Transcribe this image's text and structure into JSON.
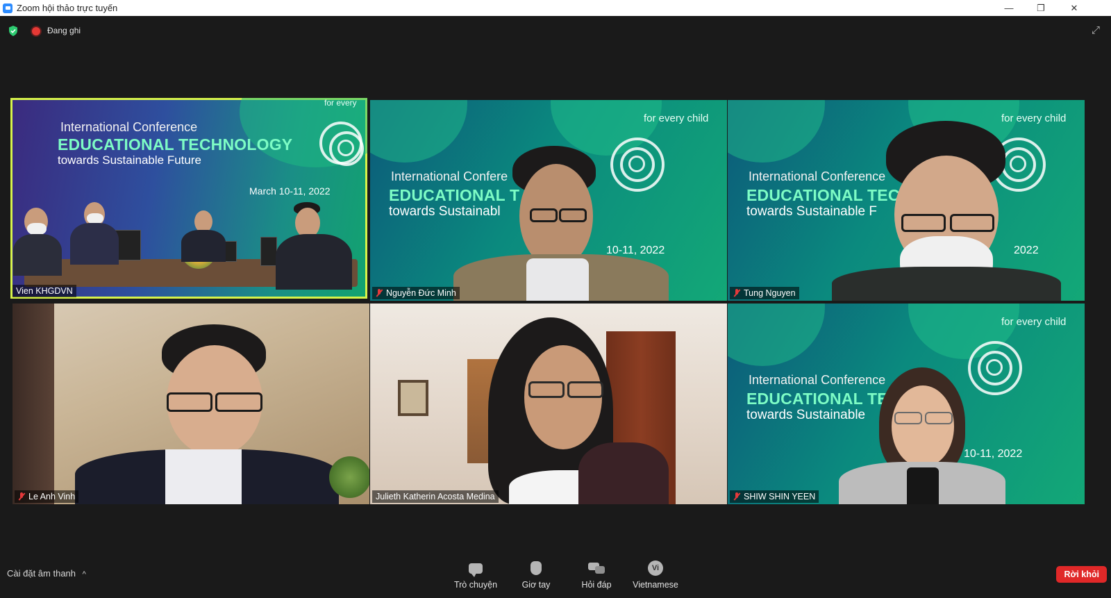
{
  "window": {
    "title": "Zoom hội thảo trực tuyến",
    "minimize": "—",
    "restore": "❐",
    "close": "✕"
  },
  "top": {
    "recording_label": "Đang ghi",
    "fullscreen_glyph": "⤢"
  },
  "tiles": [
    {
      "name": "Vien KHGDVN",
      "muted": false,
      "active": true,
      "conf_line1": "International Conference",
      "conf_line2": "EDUCATIONAL TECHNOLOGY",
      "conf_line3": "towards Sustainable Future",
      "conf_date": "March 10-11, 2022",
      "unicef": "for every"
    },
    {
      "name": "Nguyễn Đức Minh",
      "muted": true,
      "conf_line1": "International Confere",
      "conf_line2": "EDUCATIONAL T",
      "conf_line3": "towards Sustainabl",
      "conf_date": "10-11, 2022",
      "unicef": "for every child"
    },
    {
      "name": "Tung Nguyen",
      "muted": true,
      "conf_line1": "International Conference",
      "conf_line2": "EDUCATIONAL TEC",
      "conf_line3": "towards Sustainable F",
      "conf_date": "2022",
      "unicef": "for every child"
    },
    {
      "name": "Le Anh Vinh",
      "muted": true
    },
    {
      "name": "Julieth Katherin Acosta Medina",
      "muted": false
    },
    {
      "name": "SHIW SHIN YEEN",
      "muted": true,
      "conf_line1": "International Conference",
      "conf_line2": "EDUCATIONAL TEC",
      "conf_line3": "towards Sustainable",
      "conf_date": "10-11, 2022",
      "unicef": "for every child"
    }
  ],
  "bottom": {
    "audio_settings": "Cài đặt âm thanh",
    "audio_caret": "^",
    "controls": [
      {
        "label": "Trò chuyện",
        "icon": "chat-icon"
      },
      {
        "label": "Giơ tay",
        "icon": "raise-hand-icon"
      },
      {
        "label": "Hỏi đáp",
        "icon": "qa-icon"
      },
      {
        "label": "Vietnamese",
        "icon": "language-icon",
        "icon_text": "Vi"
      }
    ],
    "leave_label": "Rời khỏi"
  },
  "colors": {
    "active_speaker_border": "#d7f34a",
    "leave_button": "#e02828",
    "recording_dot": "#e53935",
    "security_shield": "#2ecc71"
  }
}
